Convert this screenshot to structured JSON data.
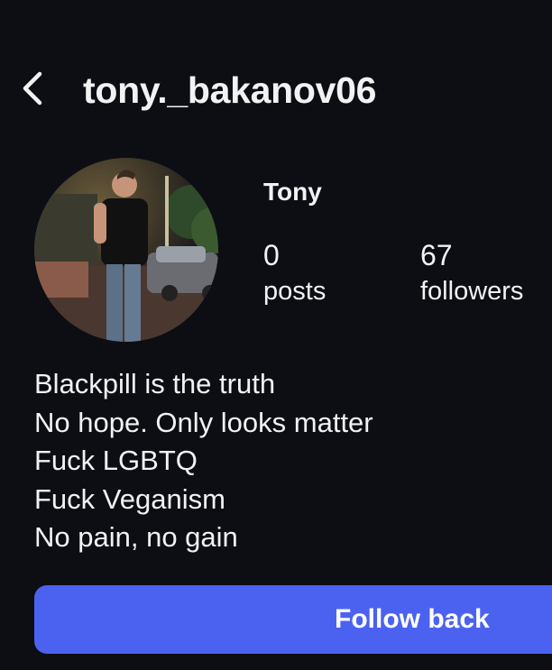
{
  "header": {
    "username": "tony._bakanov06",
    "back_icon": "chevron-left-icon"
  },
  "profile": {
    "display_name": "Tony",
    "avatar_icon": "profile-photo",
    "stats": [
      {
        "count": "0",
        "label": "posts"
      },
      {
        "count": "67",
        "label": "followers"
      }
    ]
  },
  "bio": {
    "lines": [
      "Blackpill is the truth",
      "No hope. Only looks matter",
      "Fuck LGBTQ",
      "Fuck Veganism",
      "No pain, no gain"
    ]
  },
  "actions": {
    "follow_back_label": "Follow back"
  },
  "colors": {
    "background": "#0c0e13",
    "text": "#f2f2f4",
    "accent": "#4b62f1"
  }
}
